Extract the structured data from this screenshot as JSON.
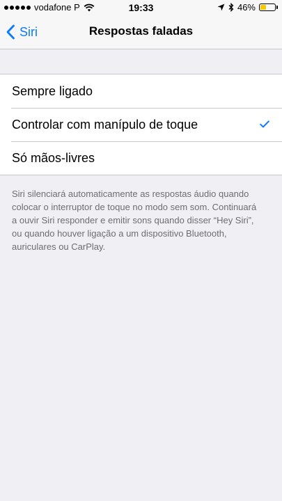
{
  "status_bar": {
    "carrier": "vodafone P",
    "time": "19:33",
    "battery_percent": "46%",
    "battery_level": 0.46,
    "battery_color": "#f5c800"
  },
  "nav": {
    "back_label": "Siri",
    "title": "Respostas faladas",
    "accent_color": "#0a7aff"
  },
  "options": [
    {
      "label": "Sempre ligado",
      "selected": false
    },
    {
      "label": "Controlar com manípulo de toque",
      "selected": true
    },
    {
      "label": "Só mãos-livres",
      "selected": false
    }
  ],
  "footer_note": "Siri silenciará automaticamente as respostas áudio quando colocar o interruptor de toque no modo sem som. Continuará a ouvir Siri responder e emitir sons quando disser “Hey Siri”, ou quando houver ligação a um dispositivo Bluetooth, auriculares ou CarPlay.",
  "icons": {
    "signal": "signal-dots-icon",
    "wifi": "wifi-icon",
    "location": "location-arrow-icon",
    "bluetooth": "bluetooth-icon",
    "battery": "battery-icon",
    "back": "chevron-left-icon",
    "selected": "checkmark-icon"
  }
}
